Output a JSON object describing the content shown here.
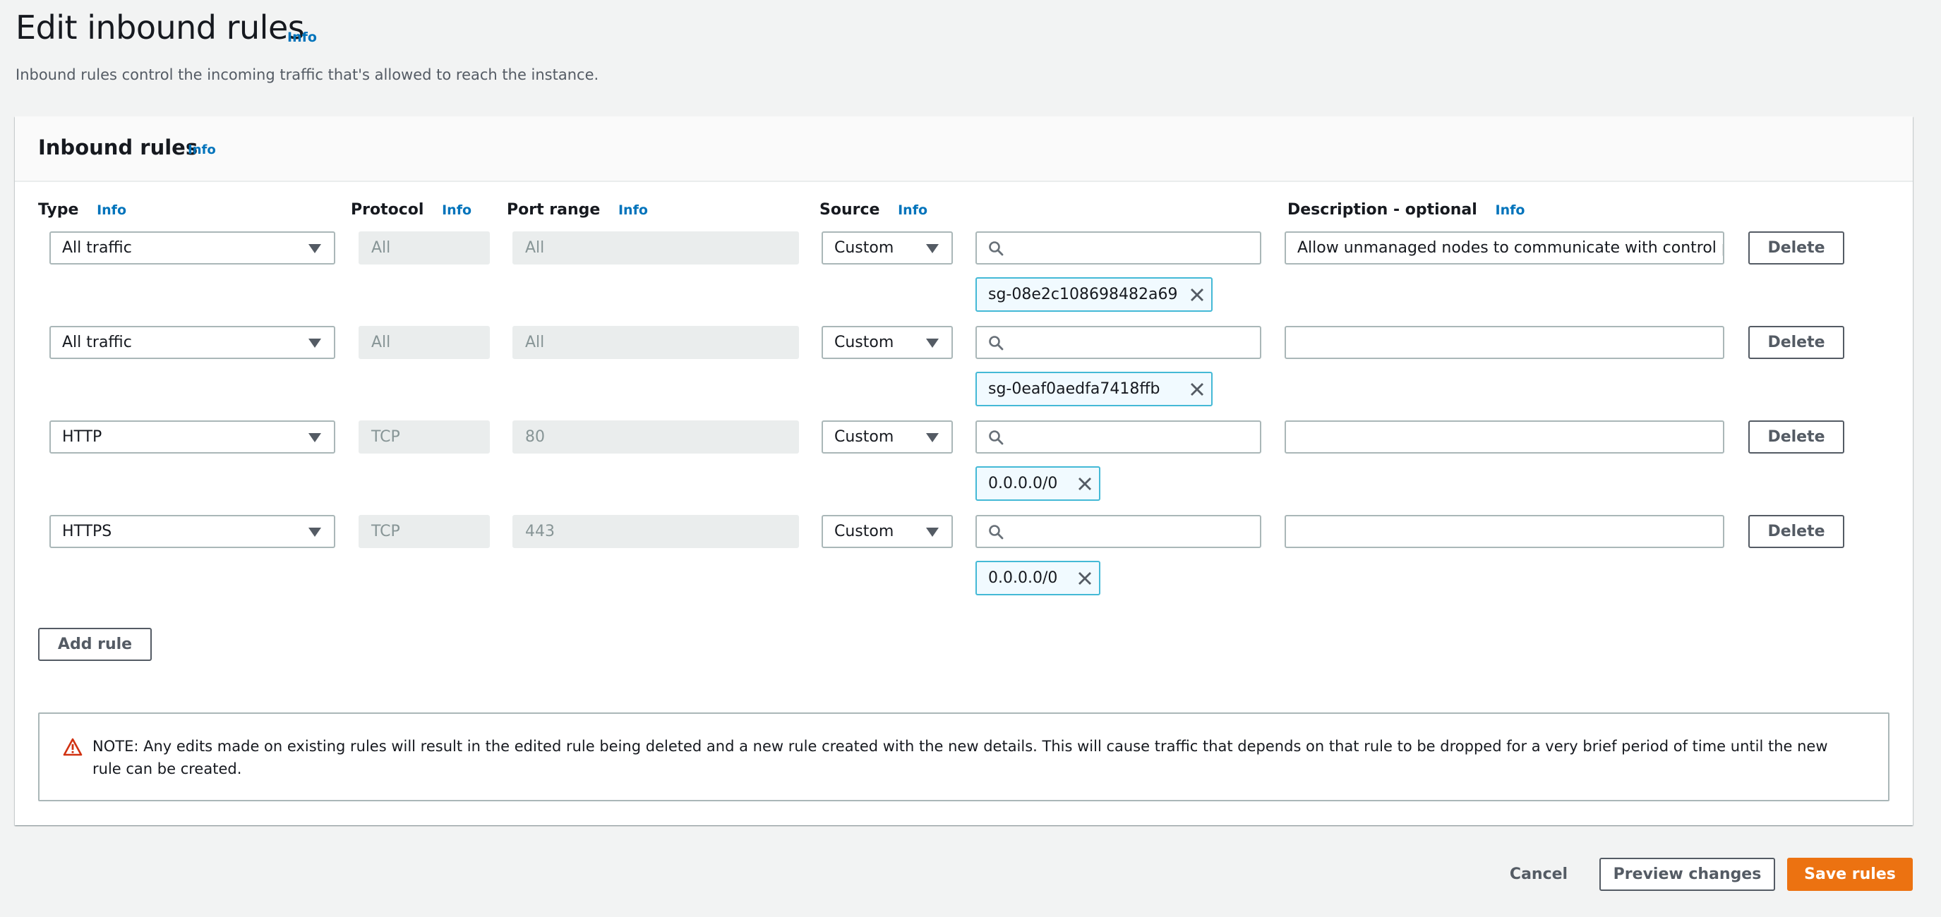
{
  "header": {
    "title": "Edit inbound rules",
    "info_label": "Info",
    "description": "Inbound rules control the incoming traffic that's allowed to reach the instance."
  },
  "panel": {
    "title": "Inbound rules",
    "info_label": "Info",
    "columns": {
      "type": "Type",
      "protocol": "Protocol",
      "port_range": "Port range",
      "source": "Source",
      "description": "Description - optional",
      "info_label": "Info"
    },
    "rules": [
      {
        "type": "All traffic",
        "protocol": "All",
        "port_range": "All",
        "source_type": "Custom",
        "source_search_value": "",
        "source_token": "sg-08e2c108698482a69",
        "description": "Allow unmanaged nodes to communicate with control pla",
        "delete_label": "Delete"
      },
      {
        "type": "All traffic",
        "protocol": "All",
        "port_range": "All",
        "source_type": "Custom",
        "source_search_value": "",
        "source_token": "sg-0eaf0aedfa7418ffb",
        "description": "",
        "delete_label": "Delete"
      },
      {
        "type": "HTTP",
        "protocol": "TCP",
        "port_range": "80",
        "source_type": "Custom",
        "source_search_value": "",
        "source_token": "0.0.0.0/0",
        "description": "",
        "delete_label": "Delete"
      },
      {
        "type": "HTTPS",
        "protocol": "TCP",
        "port_range": "443",
        "source_type": "Custom",
        "source_search_value": "",
        "source_token": "0.0.0.0/0",
        "description": "",
        "delete_label": "Delete"
      }
    ],
    "add_rule_label": "Add rule",
    "note": "NOTE: Any edits made on existing rules will result in the edited rule being deleted and a new rule created with the new details. This will cause traffic that depends on that rule to be dropped for a very brief period of time until the new rule can be created."
  },
  "footer": {
    "cancel_label": "Cancel",
    "preview_label": "Preview changes",
    "save_label": "Save rules"
  },
  "colors": {
    "accent": "#ec7211",
    "link": "#0073bb",
    "warning": "#d13212",
    "token_border": "#44b9d6",
    "token_bg": "#f1faff",
    "page_bg": "#f2f3f3"
  }
}
